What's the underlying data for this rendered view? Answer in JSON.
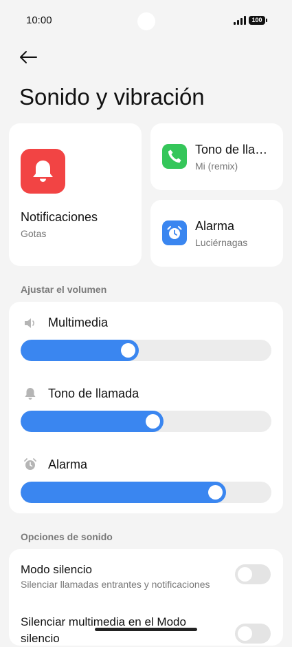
{
  "status_bar": {
    "time": "10:00",
    "battery": "100"
  },
  "header": {
    "title": "Sonido y vibración"
  },
  "cards": {
    "notifications": {
      "title": "Notificaciones",
      "subtitle": "Gotas",
      "icon": "bell-icon",
      "color": "#f24444"
    },
    "ringtone": {
      "title": "Tono de lla…",
      "subtitle": "Mi (remix)",
      "icon": "phone-icon",
      "color": "#35c65a"
    },
    "alarm": {
      "title": "Alarma",
      "subtitle": "Luciérnagas",
      "icon": "alarm-clock-icon",
      "color": "#3a86f0"
    }
  },
  "volume": {
    "section_label": "Ajustar el volumen",
    "sliders": [
      {
        "label": "Multimedia",
        "icon": "speaker-icon",
        "level": 0.47
      },
      {
        "label": "Tono de llamada",
        "icon": "bell-icon",
        "level": 0.57
      },
      {
        "label": "Alarma",
        "icon": "alarm-clock-icon",
        "level": 0.82
      }
    ],
    "accent_color": "#3a86f0"
  },
  "sound_options": {
    "section_label": "Opciones de sonido",
    "items": [
      {
        "title": "Modo silencio",
        "subtitle": "Silenciar llamadas entrantes y notificaciones",
        "enabled": false
      },
      {
        "title": "Silenciar multimedia en el Modo silencio",
        "enabled": false
      }
    ]
  }
}
